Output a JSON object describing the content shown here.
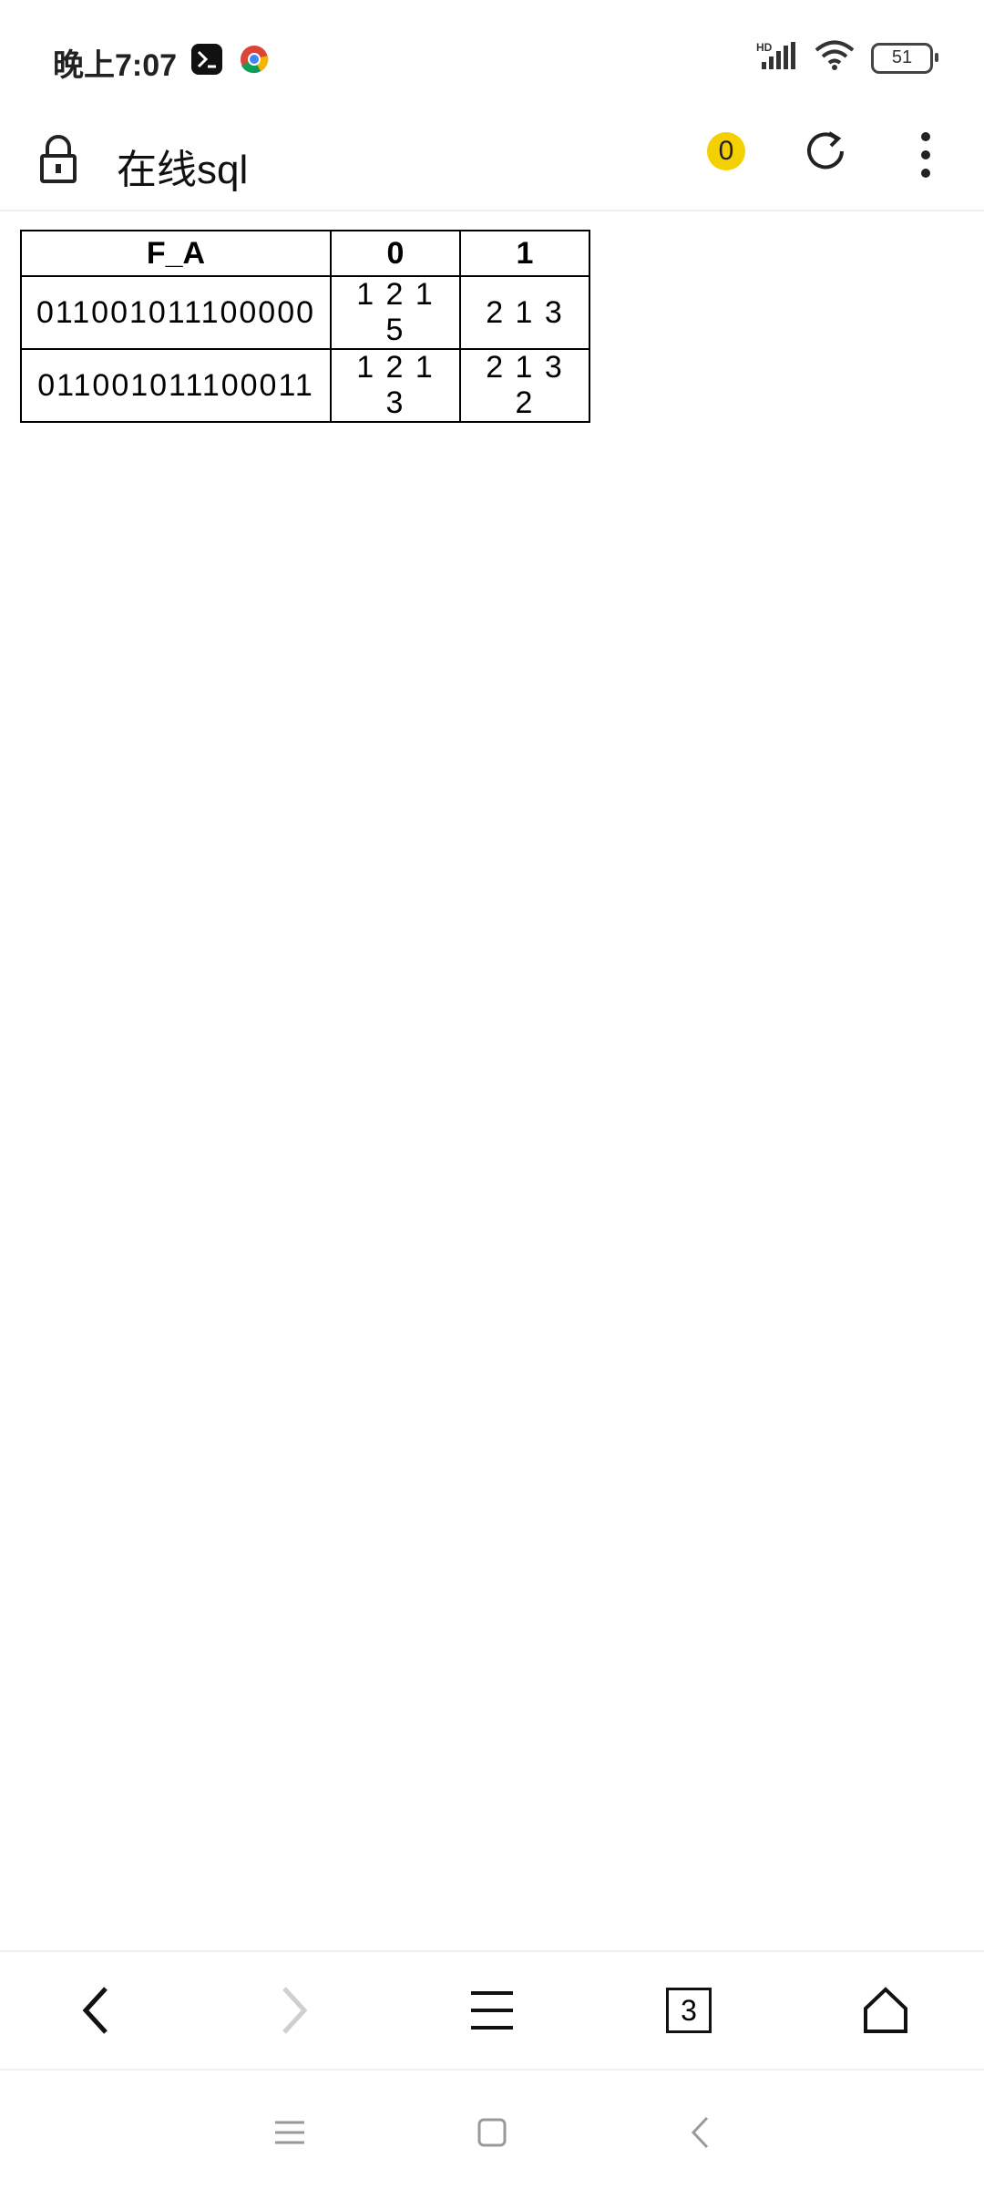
{
  "status_bar": {
    "time": "晚上7:07",
    "battery": "51",
    "network": "HD"
  },
  "browser": {
    "page_title": "在线sql",
    "badge_count": "0",
    "tabs_count": "3"
  },
  "table": {
    "headers": [
      "F_A",
      "0",
      "1"
    ],
    "rows": [
      [
        "011001011100000",
        "1 2 1 5",
        "2 1 3"
      ],
      [
        "011001011100011",
        "1 2 1 3",
        "2 1 3 2"
      ]
    ]
  }
}
